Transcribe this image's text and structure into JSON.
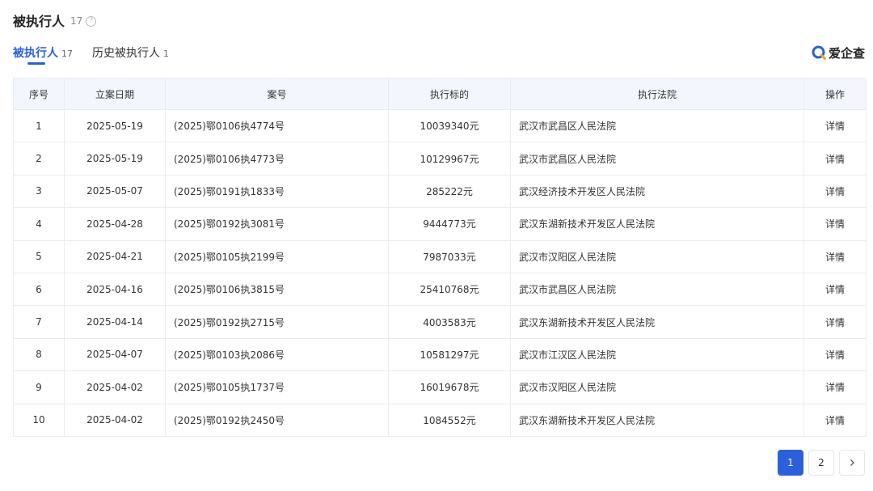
{
  "section": {
    "title": "被执行人",
    "count": "17",
    "help_icon": "question-circle-icon"
  },
  "tabs": [
    {
      "label": "被执行人",
      "count": "17",
      "active": true
    },
    {
      "label": "历史被执行人",
      "count": "1",
      "active": false
    }
  ],
  "brand": {
    "name": "爱企查",
    "logo_icon": "aiqicha-logo-icon",
    "logo_color": "#2a60db",
    "logo_accent": "#f5a623"
  },
  "table": {
    "headers": [
      "序号",
      "立案日期",
      "案号",
      "执行标的",
      "执行法院",
      "操作"
    ],
    "rows": [
      {
        "index": "1",
        "date": "2025-05-19",
        "case_no": "(2025)鄂0106执4774号",
        "amount": "10039340元",
        "court": "武汉市武昌区人民法院",
        "action": "详情"
      },
      {
        "index": "2",
        "date": "2025-05-19",
        "case_no": "(2025)鄂0106执4773号",
        "amount": "10129967元",
        "court": "武汉市武昌区人民法院",
        "action": "详情"
      },
      {
        "index": "3",
        "date": "2025-05-07",
        "case_no": "(2025)鄂0191执1833号",
        "amount": "285222元",
        "court": "武汉经济技术开发区人民法院",
        "action": "详情"
      },
      {
        "index": "4",
        "date": "2025-04-28",
        "case_no": "(2025)鄂0192执3081号",
        "amount": "9444773元",
        "court": "武汉东湖新技术开发区人民法院",
        "action": "详情"
      },
      {
        "index": "5",
        "date": "2025-04-21",
        "case_no": "(2025)鄂0105执2199号",
        "amount": "7987033元",
        "court": "武汉市汉阳区人民法院",
        "action": "详情"
      },
      {
        "index": "6",
        "date": "2025-04-16",
        "case_no": "(2025)鄂0106执3815号",
        "amount": "25410768元",
        "court": "武汉市武昌区人民法院",
        "action": "详情"
      },
      {
        "index": "7",
        "date": "2025-04-14",
        "case_no": "(2025)鄂0192执2715号",
        "amount": "4003583元",
        "court": "武汉东湖新技术开发区人民法院",
        "action": "详情"
      },
      {
        "index": "8",
        "date": "2025-04-07",
        "case_no": "(2025)鄂0103执2086号",
        "amount": "10581297元",
        "court": "武汉市江汉区人民法院",
        "action": "详情"
      },
      {
        "index": "9",
        "date": "2025-04-02",
        "case_no": "(2025)鄂0105执1737号",
        "amount": "16019678元",
        "court": "武汉市汉阳区人民法院",
        "action": "详情"
      },
      {
        "index": "10",
        "date": "2025-04-02",
        "case_no": "(2025)鄂0192执2450号",
        "amount": "1084552元",
        "court": "武汉东湖新技术开发区人民法院",
        "action": "详情"
      }
    ]
  },
  "pagination": {
    "pages": [
      "1",
      "2"
    ],
    "current": "1",
    "next_icon": "chevron-right-icon"
  },
  "colors": {
    "accent": "#2a60db",
    "header_bg": "#f3f7fd",
    "border": "#e9edf3"
  }
}
